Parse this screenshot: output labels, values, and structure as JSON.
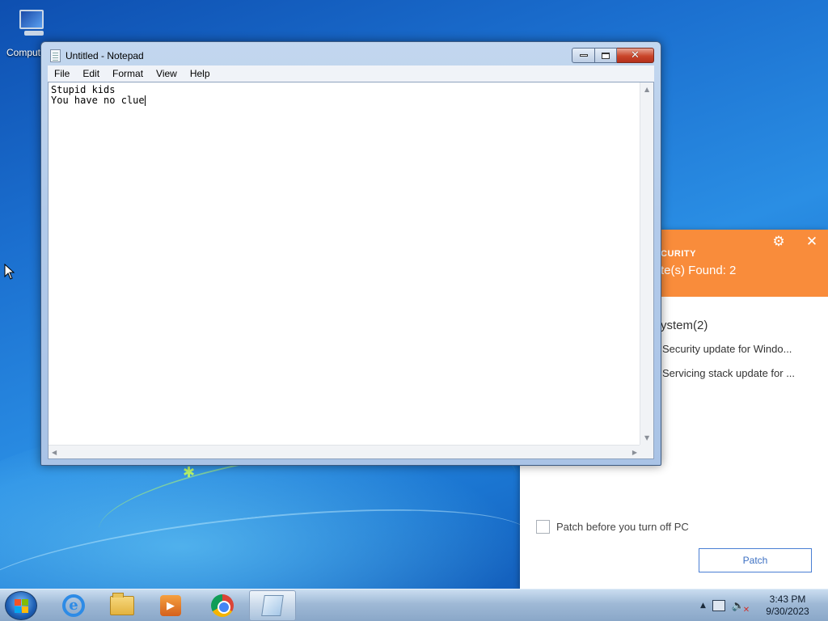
{
  "desktop": {
    "icons": [
      {
        "label": "Computer",
        "icon": "computer-icon"
      }
    ]
  },
  "notepad": {
    "title": "Untitled - Notepad",
    "menu": [
      "File",
      "Edit",
      "Format",
      "View",
      "Help"
    ],
    "lines": [
      "Stupid kids",
      "You have no clue"
    ],
    "buttons": {
      "minimize": "minimize-icon",
      "maximize": "maximize-icon",
      "close": "close-icon"
    }
  },
  "security_panel": {
    "brand_partial": "CURITY",
    "found_partial": "te(s) Found: 2",
    "category_partial": "ystem(2)",
    "updates": [
      "Security update for Windo...",
      "Servicing stack update for ..."
    ],
    "checkbox_label": "Patch before you turn off PC",
    "checkbox_checked": false,
    "patch_button": "Patch",
    "accent_color": "#f98c3b",
    "icons": {
      "settings": "gear-icon",
      "close": "close-icon"
    }
  },
  "taskbar": {
    "apps": [
      {
        "name": "Internet Explorer",
        "icon": "ie-icon",
        "active": false
      },
      {
        "name": "Windows Explorer",
        "icon": "folder-icon",
        "active": false
      },
      {
        "name": "Windows Media Player",
        "icon": "media-player-icon",
        "active": false
      },
      {
        "name": "Google Chrome",
        "icon": "chrome-icon",
        "active": false
      },
      {
        "name": "Notepad",
        "icon": "notepad-icon",
        "active": true
      }
    ],
    "tray": {
      "up_arrow": "▲",
      "network": "network-icon",
      "volume": "volume-muted-icon"
    },
    "clock": {
      "time": "3:43 PM",
      "date": "9/30/2023"
    }
  }
}
